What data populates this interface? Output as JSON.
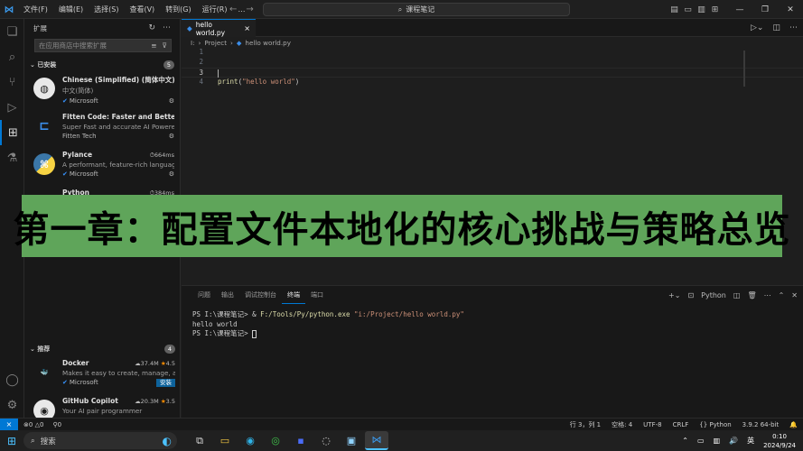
{
  "titlebar": {
    "menu": [
      "文件(F)",
      "编辑(E)",
      "选择(S)",
      "查看(V)",
      "转到(G)",
      "运行(R)",
      "…"
    ],
    "search": "课程笔记"
  },
  "sidebar": {
    "title": "扩展",
    "search_placeholder": "在应用商店中搜索扩展",
    "installed_label": "已安装",
    "installed_count": "5",
    "installed": [
      {
        "name": "Chinese (Simplified) (简体中文) L...",
        "desc": "中文(简体)",
        "publisher": "Microsoft",
        "verified": true,
        "meta": ""
      },
      {
        "name": "Fitten Code: Faster and Better AI ...",
        "desc": "Super Fast and accurate AI Powered...",
        "publisher": "Fitten Tech",
        "verified": false,
        "meta": ""
      },
      {
        "name": "Pylance",
        "desc": "A performant, feature-rich languag...",
        "publisher": "Microsoft",
        "verified": true,
        "meta": "664ms"
      },
      {
        "name": "Python",
        "desc": "",
        "publisher": "",
        "verified": false,
        "meta": "384ms"
      }
    ],
    "recommended_label": "推荐",
    "recommended_count": "4",
    "recommended": [
      {
        "name": "Docker",
        "desc": "Makes it easy to create, manage, an...",
        "publisher": "Microsoft",
        "downloads": "37.4M",
        "rating": "4.5",
        "install": "安装"
      },
      {
        "name": "GitHub Copilot",
        "desc": "Your AI pair programmer",
        "publisher": "",
        "downloads": "20.3M",
        "rating": "3.5",
        "install": ""
      }
    ]
  },
  "editor": {
    "tab": "hello world.py",
    "breadcrumb": [
      "I:",
      "Project",
      "hello world.py"
    ],
    "lines": [
      {
        "n": "1",
        "text": ""
      },
      {
        "n": "2",
        "text": ""
      },
      {
        "n": "3",
        "text": ""
      },
      {
        "n": "4",
        "fn": "print",
        "p1": "(",
        "str": "\"hello world\"",
        "p2": ")"
      }
    ]
  },
  "banner": {
    "text": "第一章：配置文件本地化的核心挑战与策略总览"
  },
  "panel": {
    "tabs": [
      "问题",
      "输出",
      "调试控制台",
      "终端",
      "端口"
    ],
    "active_tab": "终端",
    "shell": "Python",
    "terminal": {
      "prompt1": "PS I:\\课程笔记> ",
      "cmd_amp": "& ",
      "cmd_exe": "F:/Tools/Py/python.exe",
      "cmd_arg": " \"i:/Project/hello world.py\"",
      "output": "hello world",
      "prompt2": "PS I:\\课程笔记> "
    }
  },
  "statusbar": {
    "errors": "0",
    "warnings": "0",
    "ports": "0",
    "position": "行 3，列 1",
    "spaces": "空格: 4",
    "encoding": "UTF-8",
    "eol": "CRLF",
    "language": "Python",
    "interpreter": "3.9.2 64-bit"
  },
  "taskbar": {
    "search": "搜索",
    "ime": "英",
    "time": "0:10",
    "date": "2024/9/24"
  },
  "colors": {
    "accent": "#0078d4",
    "banner_bg": "#5fa55a"
  }
}
